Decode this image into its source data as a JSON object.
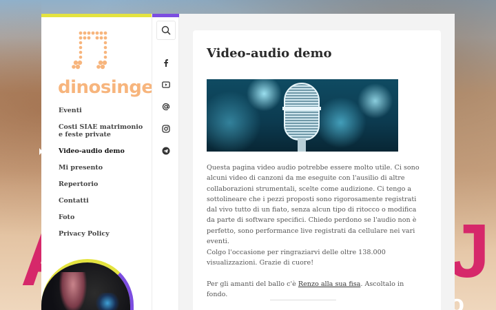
{
  "colors": {
    "accent_yellow": "#e4e33f",
    "accent_purple": "#7c4de0",
    "logo_orange": "#f7b57d",
    "background_magenta": "#d6286a"
  },
  "background": {
    "letter_left": "A",
    "letter_right": "J",
    "letter_bottom_right": "o"
  },
  "sidebar": {
    "logo_text": "dinosinger",
    "logo_icon": "music-note-dots-icon",
    "menu": [
      {
        "label": "Eventi",
        "active": false
      },
      {
        "label": "Costi SIAE matrimonio e feste private",
        "active": false
      },
      {
        "label": "Video-audio demo",
        "active": true
      },
      {
        "label": "Mi presento",
        "active": false
      },
      {
        "label": "Repertorio",
        "active": false
      },
      {
        "label": "Contatti",
        "active": false
      },
      {
        "label": "Foto",
        "active": false
      },
      {
        "label": "Privacy Policy",
        "active": false
      }
    ]
  },
  "icon_rail": {
    "search_icon": "search-icon",
    "social": [
      "facebook-icon",
      "youtube-icon",
      "email-icon",
      "instagram-icon",
      "telegram-icon"
    ]
  },
  "content": {
    "title": "Video-audio demo",
    "hero_image": "microphone-image",
    "paragraph1": "Questa pagina video audio potrebbe essere molto utile. Ci sono alcuni video di canzoni da me eseguite con l'ausilio di altre collaborazioni strumentali, scelte come audizione. Ci tengo a sottolineare che i pezzi proposti sono rigorosamente registrati dal vivo tutto di un fiato, senza alcun tipo di ritocco o modifica da parte di software specifici. Chiedo perdono se l'audio non è perfetto, sono performance live registrati da cellulare nei vari eventi.",
    "paragraph2": "Colgo l'occasione per ringraziarvi delle oltre 138.000 visualizzazioni. Grazie di cuore!",
    "paragraph3_prefix": "Per gli amanti del ballo c'è ",
    "paragraph3_link": "Renzo alla sua fisa",
    "paragraph3_suffix": ". Ascoltalo in fondo."
  }
}
